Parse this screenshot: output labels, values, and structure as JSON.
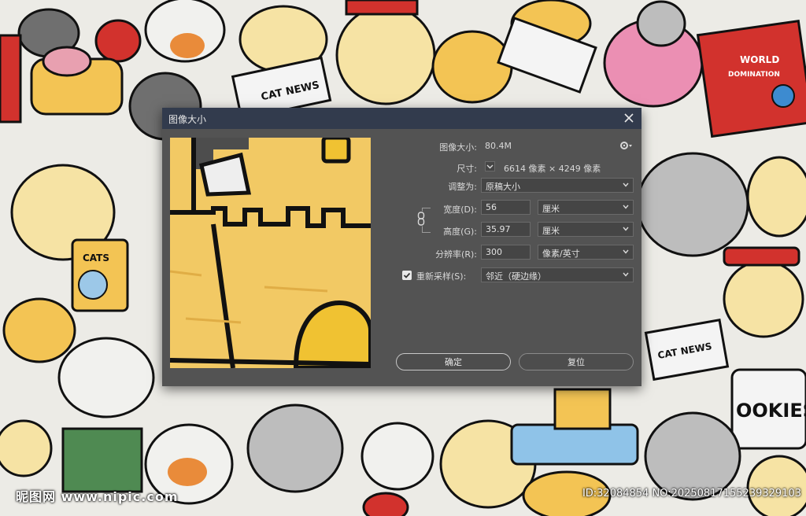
{
  "background": {
    "labels": {
      "cat_news_top": "CAT NEWS",
      "world_domination_1": "WORLD",
      "world_domination_2": "DOMINATION",
      "cats_bag": "CATS",
      "cat_news_bottom": "CAT NEWS",
      "cookies": "OOKIES"
    }
  },
  "dialog": {
    "title": "图像大小",
    "image_size_label": "图像大小:",
    "image_size_value": "80.4M",
    "dimensions_label": "尺寸:",
    "dimensions_value": "6614 像素 × 4249 像素",
    "fit_to_label": "调整为:",
    "fit_to_value": "原稿大小",
    "width_label": "宽度(D):",
    "width_value": "56",
    "width_unit": "厘米",
    "height_label": "高度(G):",
    "height_value": "35.97",
    "height_unit": "厘米",
    "resolution_label": "分辨率(R):",
    "resolution_value": "300",
    "resolution_unit": "像素/英寸",
    "resample_label": "重新采样(S):",
    "resample_value": "邻近（硬边缘）",
    "ok_label": "确定",
    "reset_label": "复位"
  },
  "watermark": {
    "left": "昵图网 www.nipic.com",
    "right": "ID:32084854 NO:20250817155239329103"
  },
  "colors": {
    "dialog_bg": "#535353",
    "titlebar_bg": "#323b4d",
    "preview_fill": "#f2c964"
  }
}
